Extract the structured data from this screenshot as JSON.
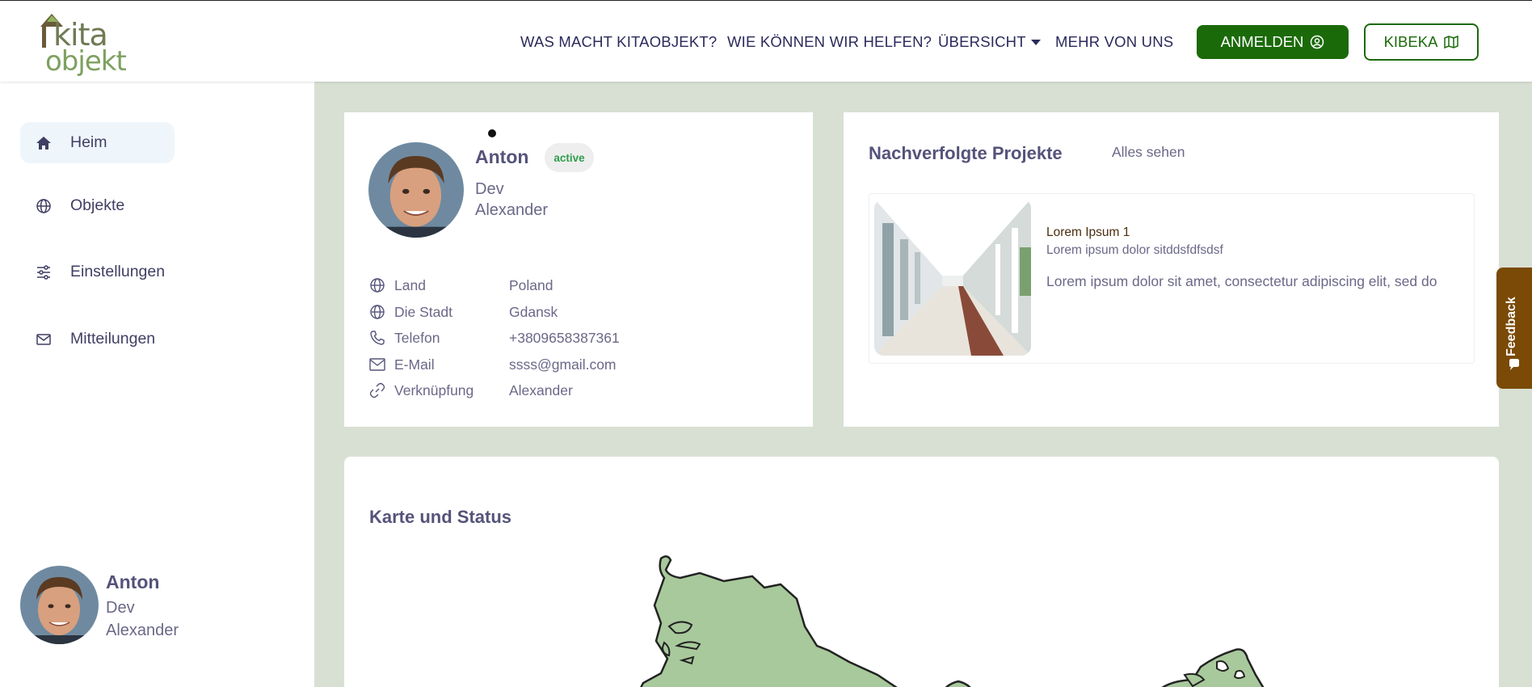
{
  "header": {
    "logo_top": "kita",
    "logo_bottom": "objekt",
    "nav": [
      "WAS MACHT KITAOBJEKT?",
      "WIE KÖNNEN WIR HELFEN?",
      "ÜBERSICHT",
      "MEHR VON UNS"
    ],
    "login_label": "ANMELDEN",
    "kibeka_label": "KIBEKA"
  },
  "sidebar": {
    "items": [
      {
        "label": "Heim",
        "icon": "home-icon"
      },
      {
        "label": "Objekte",
        "icon": "globe-icon"
      },
      {
        "label": "Einstellungen",
        "icon": "sliders-icon"
      },
      {
        "label": "Mitteilungen",
        "icon": "mail-icon"
      }
    ],
    "user": {
      "name": "Anton",
      "role": "Dev",
      "last_name": "Alexander"
    }
  },
  "profile": {
    "name": "Anton",
    "status": "active",
    "role": "Dev",
    "last_name": "Alexander",
    "rows": [
      {
        "label": "Land",
        "value": "Poland",
        "icon": "globe-icon"
      },
      {
        "label": "Die Stadt",
        "value": "Gdansk",
        "icon": "globe-icon"
      },
      {
        "label": "Telefon",
        "value": "+3809658387361",
        "icon": "phone-icon"
      },
      {
        "label": "E-Mail",
        "value": "ssss@gmail.com",
        "icon": "mail-icon"
      },
      {
        "label": "Verknüpfung",
        "value": "Alexander",
        "icon": "link-icon"
      }
    ]
  },
  "projects": {
    "title": "Nachverfolgte Projekte",
    "see_all": "Alles sehen",
    "items": [
      {
        "name": "Lorem Ipsum 1",
        "subtitle": "Lorem ipsum dolor sitddsfdfsdsf",
        "description": "Lorem ipsum dolor sit amet, consectetur adipiscing elit, sed do"
      }
    ]
  },
  "map": {
    "title": "Karte und Status",
    "land_color": "#a8c99c"
  },
  "feedback": {
    "label": "Feedback"
  },
  "colors": {
    "accent": "#1b6a0a",
    "main_bg": "#d8e0d4",
    "feedback_bg": "#7a4a06",
    "active_badge": "#2e9e4c"
  }
}
